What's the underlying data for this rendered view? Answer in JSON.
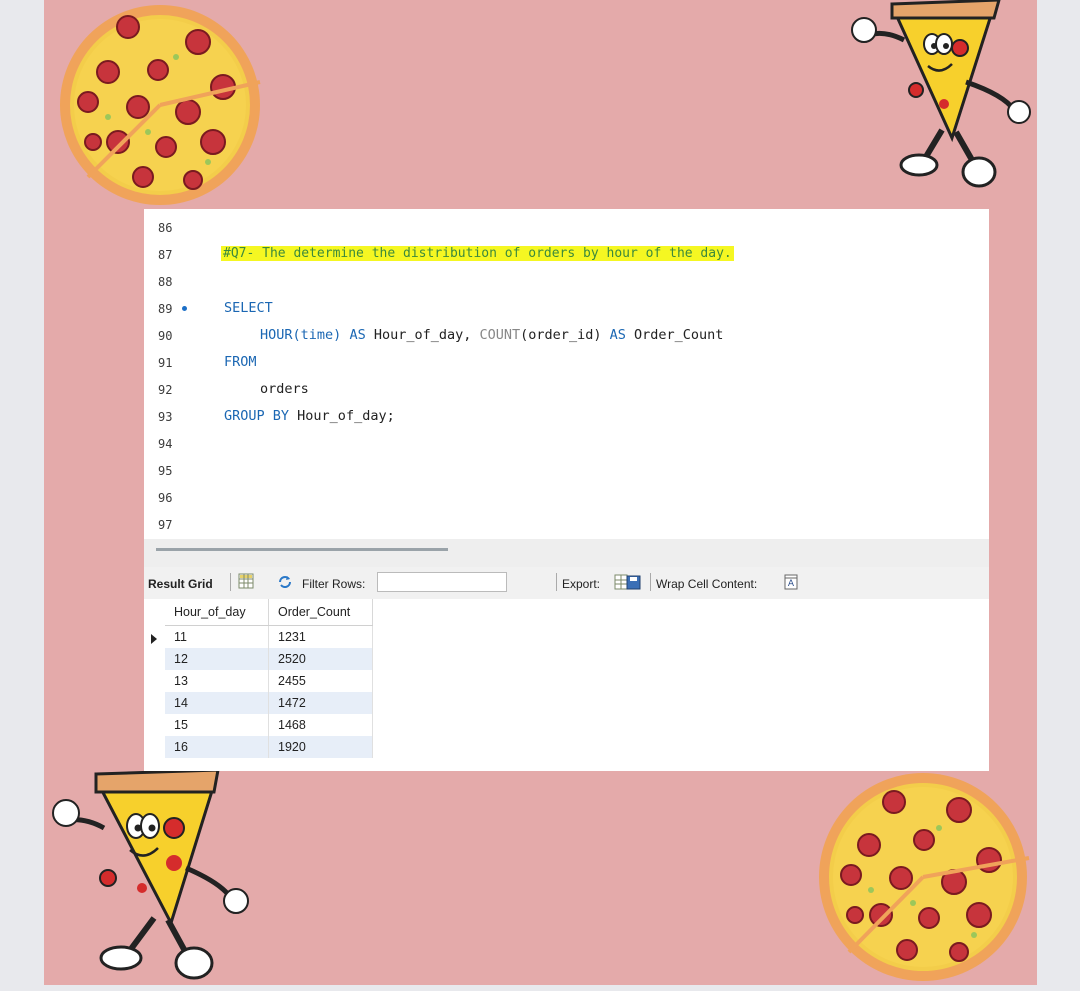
{
  "colors": {
    "background": "#e4aaaa",
    "comment_highlight": "#f5f722",
    "keyword": "#1b67b3"
  },
  "editor": {
    "line_numbers": [
      "86",
      "87",
      "88",
      "89",
      "90",
      "91",
      "92",
      "93",
      "94",
      "95",
      "96",
      "97"
    ],
    "comment": "#Q7- The determine the distribution of orders by hour of the day.",
    "sql": {
      "select": "SELECT",
      "hour_fn": "HOUR",
      "hour_arg": "(time)",
      "as1": "AS",
      "alias1": "Hour_of_day,",
      "count_fn": "COUNT",
      "count_arg": "(order_id)",
      "as2": "AS",
      "alias2": "Order_Count",
      "from": "FROM",
      "table": "orders",
      "group_by": "GROUP BY",
      "group_col": "Hour_of_day;"
    }
  },
  "toolbar": {
    "result_grid": "Result Grid",
    "filter_rows": "Filter Rows:",
    "filter_value": "",
    "export": "Export:",
    "wrap_cell": "Wrap Cell Content:"
  },
  "grid": {
    "columns": [
      "Hour_of_day",
      "Order_Count"
    ],
    "rows": [
      [
        "11",
        "1231"
      ],
      [
        "12",
        "2520"
      ],
      [
        "13",
        "2455"
      ],
      [
        "14",
        "1472"
      ],
      [
        "15",
        "1468"
      ],
      [
        "16",
        "1920"
      ]
    ]
  },
  "decorations": [
    "pizza-icon",
    "pizza-mascot-icon",
    "pizza-mascot-icon",
    "pizza-icon"
  ]
}
